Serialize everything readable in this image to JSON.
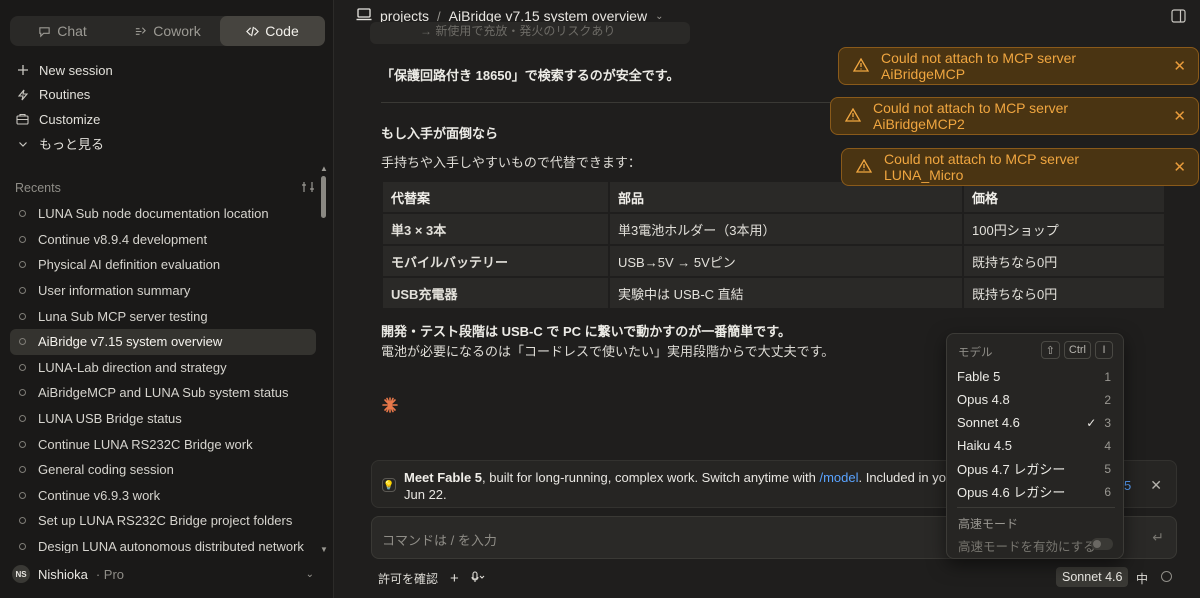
{
  "sidebar": {
    "tabs": [
      {
        "label": "Chat",
        "icon": "chat-bubble-icon"
      },
      {
        "label": "Cowork",
        "icon": "cowork-icon"
      },
      {
        "label": "Code",
        "icon": "code-icon",
        "active": true
      }
    ],
    "nav": [
      {
        "label": "New session",
        "icon": "plus-icon"
      },
      {
        "label": "Routines",
        "icon": "bolt-icon"
      },
      {
        "label": "Customize",
        "icon": "briefcase-icon"
      },
      {
        "label": "もっと見る",
        "icon": "chevron-down-icon"
      }
    ],
    "recents_label": "Recents",
    "recents": [
      "LUNA Sub node documentation location",
      "Continue v8.9.4 development",
      "Physical AI definition evaluation",
      "User information summary",
      "Luna Sub MCP server testing",
      "AiBridge v7.15 system overview",
      "LUNA-Lab direction and strategy",
      "AiBridgeMCP and LUNA Sub system status",
      "LUNA USB Bridge status",
      "Continue LUNA RS232C Bridge work",
      "General coding session",
      "Continue v6.9.3 work",
      "Set up LUNA RS232C Bridge project folders",
      "Design LUNA autonomous distributed network"
    ],
    "active_recent_index": 5,
    "user": {
      "initials": "NS",
      "name": "Nishioka",
      "plan": "· Pro"
    }
  },
  "header": {
    "project": "projects",
    "separator": "/",
    "title": "AiBridge v7.15 system overview"
  },
  "content": {
    "faded_line": "→ 新使用で充放・発火のリスクあり",
    "para1": "「保護回路付き 18650」で検索するのが安全です。",
    "heading": "もし入手が面倒なら",
    "para2": "手持ちや入手しやすいもので代替できます：",
    "table": {
      "headers": [
        "代替案",
        "部品",
        "価格"
      ],
      "rows": [
        [
          "単3 × 3本",
          "単3電池ホルダー（3本用）",
          "100円ショップ"
        ],
        [
          "モバイルバッテリー",
          "USB→5V → 5Vピン",
          "既持ちなら0円"
        ],
        [
          "USB充電器",
          "実験中は USB-C 直結",
          "既持ちなら0円"
        ]
      ]
    },
    "para3": "開発・テスト段階は USB-C で PC に繋いで動かすのが一番簡単です。",
    "para4": "電池が必要になるのは「コードレスで使いたい」実用段階からで大丈夫です。"
  },
  "toasts": [
    "Could not attach to MCP server AiBridgeMCP",
    "Could not attach to MCP server AiBridgeMCP2",
    "Could not attach to MCP server LUNA_Micro"
  ],
  "banner": {
    "bold": "Meet Fable 5",
    "text": ", built for long-running, complex work. Switch anytime with ",
    "link": "/model",
    "text2": ". Included in yo",
    "line2": "Jun 22.",
    "tail": "5"
  },
  "input": {
    "placeholder": "コマンドは / を入力"
  },
  "bottom": {
    "permission": "許可を確認",
    "plus": "+",
    "model": "Sonnet 4.6",
    "speed": "中"
  },
  "model_menu": {
    "header": "モデル",
    "keys": [
      "⇧",
      "Ctrl",
      "I"
    ],
    "items": [
      {
        "label": "Fable 5",
        "num": "1"
      },
      {
        "label": "Opus 4.8",
        "num": "2"
      },
      {
        "label": "Sonnet 4.6",
        "num": "3",
        "checked": true
      },
      {
        "label": "Haiku 4.5",
        "num": "4"
      },
      {
        "label": "Opus 4.7 レガシー",
        "num": "5"
      },
      {
        "label": "Opus 4.6 レガシー",
        "num": "6"
      }
    ],
    "fast_header": "高速モード",
    "fast_label": "高速モードを有効にする"
  },
  "colors": {
    "accent_orange": "#f0a640",
    "link_blue": "#5aa3ff",
    "spark": "#e8784a"
  }
}
